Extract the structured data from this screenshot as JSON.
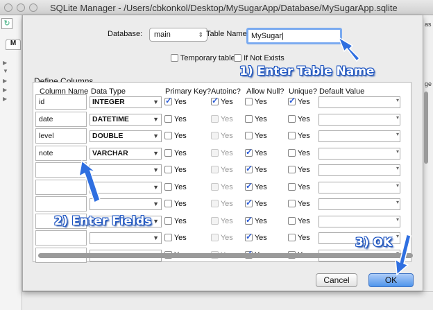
{
  "window": {
    "title": "SQLite Manager - /Users/cbkonkol/Desktop/MySugarApp/Database/MySugarApp.sqlite"
  },
  "background": {
    "tab_label": "M",
    "right_fragment_1": "as",
    "right_fragment_2": "ge"
  },
  "dialog": {
    "database_label": "Database:",
    "database_value": "main",
    "table_name_label": "Table Name:",
    "table_name_value": "MySugar",
    "temporary_label": "Temporary table",
    "if_not_exists_label": "If Not Exists",
    "section_title": "Define Columns",
    "headers": {
      "name": "Column Name",
      "type": "Data Type",
      "pk": "Primary Key?",
      "ai": "Autoinc?",
      "null": "Allow Null?",
      "unique": "Unique?",
      "default": "Default Value"
    },
    "checkbox_label": "Yes",
    "rows": [
      {
        "name": "id",
        "type": "INTEGER",
        "pk": true,
        "ai": true,
        "ai_enabled": true,
        "null": false,
        "unique": true
      },
      {
        "name": "date",
        "type": "DATETIME",
        "pk": false,
        "ai": false,
        "ai_enabled": false,
        "null": false,
        "unique": false
      },
      {
        "name": "level",
        "type": "DOUBLE",
        "pk": false,
        "ai": false,
        "ai_enabled": false,
        "null": false,
        "unique": false
      },
      {
        "name": "note",
        "type": "VARCHAR",
        "pk": false,
        "ai": false,
        "ai_enabled": false,
        "null": true,
        "unique": false
      },
      {
        "name": "",
        "type": "",
        "pk": false,
        "ai": false,
        "ai_enabled": false,
        "null": true,
        "unique": false
      },
      {
        "name": "",
        "type": "",
        "pk": false,
        "ai": false,
        "ai_enabled": false,
        "null": true,
        "unique": false
      },
      {
        "name": "",
        "type": "",
        "pk": false,
        "ai": false,
        "ai_enabled": false,
        "null": true,
        "unique": false
      },
      {
        "name": "",
        "type": "",
        "pk": false,
        "ai": false,
        "ai_enabled": false,
        "null": true,
        "unique": false
      },
      {
        "name": "",
        "type": "",
        "pk": false,
        "ai": false,
        "ai_enabled": false,
        "null": true,
        "unique": false
      },
      {
        "name": "",
        "type": "",
        "pk": false,
        "ai": false,
        "ai_enabled": false,
        "null": true,
        "unique": false
      }
    ],
    "cancel_label": "Cancel",
    "ok_label": "OK"
  },
  "annotations": {
    "step1": "1) Enter Table Name",
    "step2": "2) Enter Fields",
    "step3": "3) OK",
    "color": "#2f6fe0"
  }
}
